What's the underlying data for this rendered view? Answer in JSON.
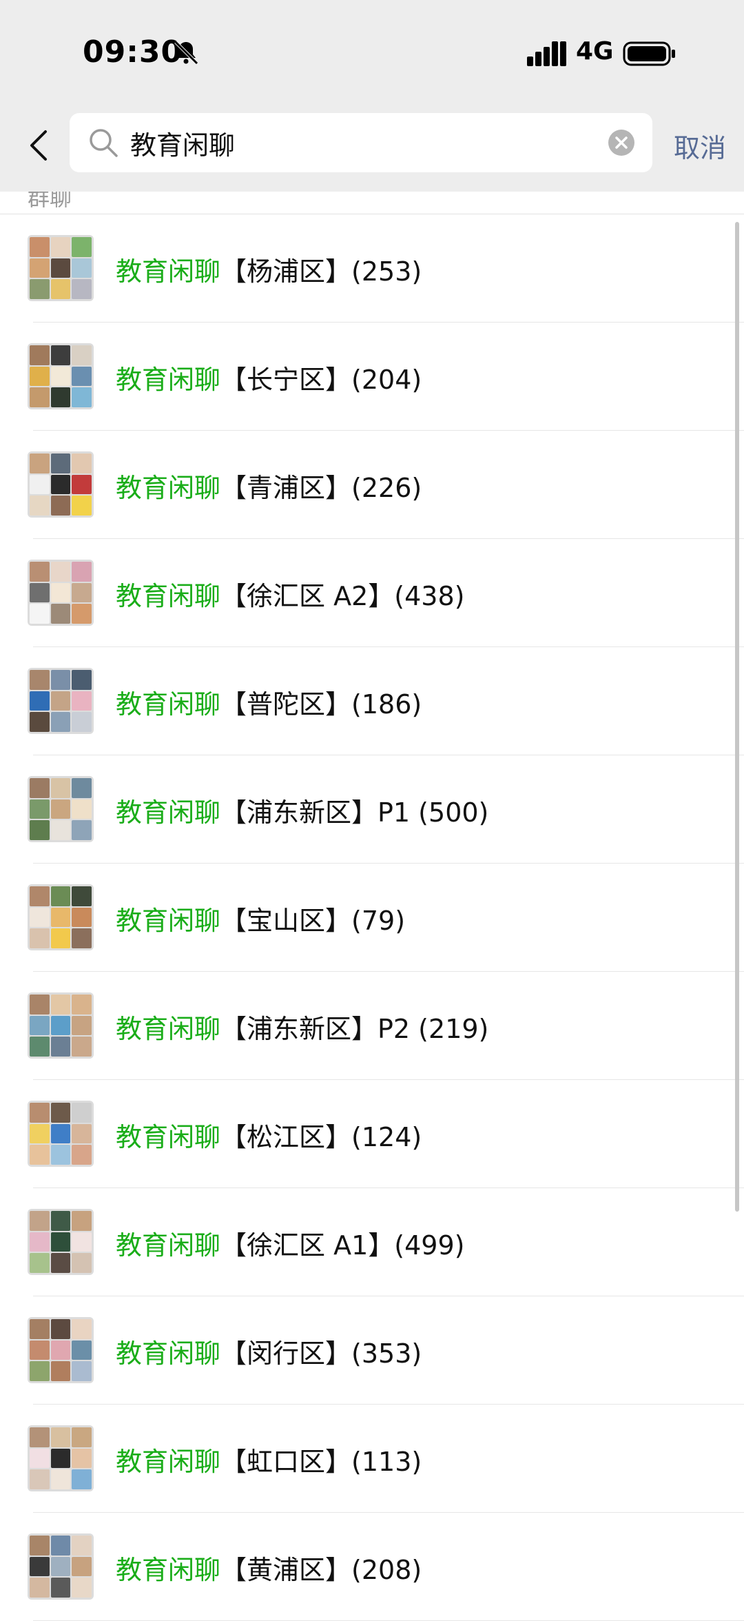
{
  "status_bar": {
    "time": "09:30",
    "network": "4G",
    "icons": [
      "bell-mute-icon",
      "signal-icon",
      "battery-icon"
    ]
  },
  "search": {
    "query": "教育闲聊",
    "cancel_label": "取消",
    "icons": [
      "back-chevron-icon",
      "search-icon",
      "clear-icon"
    ]
  },
  "section": {
    "title": "群聊"
  },
  "colors": {
    "highlight": "#1aad19",
    "cancel": "#576b95",
    "header_bg": "#ededed"
  },
  "results": [
    {
      "prefix": "教育闲聊",
      "suffix": "【杨浦区】(253)"
    },
    {
      "prefix": "教育闲聊",
      "suffix": "【长宁区】(204)"
    },
    {
      "prefix": "教育闲聊",
      "suffix": "【青浦区】(226)"
    },
    {
      "prefix": "教育闲聊",
      "suffix": "【徐汇区 A2】(438)"
    },
    {
      "prefix": "教育闲聊",
      "suffix": "【普陀区】(186)"
    },
    {
      "prefix": "教育闲聊",
      "suffix": "【浦东新区】P1 (500)"
    },
    {
      "prefix": "教育闲聊",
      "suffix": "【宝山区】(79)"
    },
    {
      "prefix": "教育闲聊",
      "suffix": "【浦东新区】P2 (219)"
    },
    {
      "prefix": "教育闲聊",
      "suffix": "【松江区】(124)"
    },
    {
      "prefix": "教育闲聊",
      "suffix": "【徐汇区 A1】(499)"
    },
    {
      "prefix": "教育闲聊",
      "suffix": "【闵行区】(353)"
    },
    {
      "prefix": "教育闲聊",
      "suffix": "【虹口区】(113)"
    },
    {
      "prefix": "教育闲聊",
      "suffix": "【黄浦区】(208)"
    }
  ]
}
